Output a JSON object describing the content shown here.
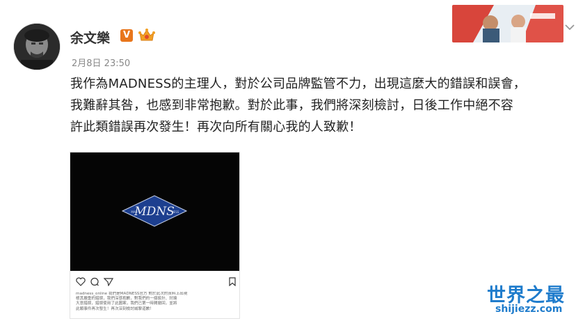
{
  "post": {
    "author": "余文樂",
    "verified_badge": "V",
    "timestamp": "2月8日 23:50",
    "text": "我作為MADNESS的主理人，對於公司品牌監管不力，出現這麼大的錯誤和誤會，\n我難辭其咎，也感到非常抱歉。對於此事，我們將深刻檢討，日後工作中絕不容\n許此類錯誤再次發生！再次向所有關心我的人致歉！"
  },
  "embedded_post": {
    "logo_text": "MDNS",
    "logo_left": "MAD",
    "logo_right": "NESS",
    "caption": "madness_online 我們是MADNESS官方 對於此次的資料上出現\n極其嚴重的錯誤，我們深感抱歉，對我們的一個設計、討論\n大意錯誤，錯誤使用了此圖案，我們已第一時間撤回，並將\n此類事件再次發生！再次深刻檢討誠摯道歉！"
  },
  "watermark": {
    "title": "世界之最",
    "url": "shijiezz.com"
  },
  "colors": {
    "badge_orange": "#e8761c",
    "watermark_blue": "#1f7ccc",
    "logo_blue": "#1d3f8f"
  },
  "icons": [
    "avatar",
    "verified-icon",
    "member-crown-icon",
    "chevron-down-icon",
    "heart-icon",
    "comment-icon",
    "share-icon",
    "bookmark-icon"
  ]
}
